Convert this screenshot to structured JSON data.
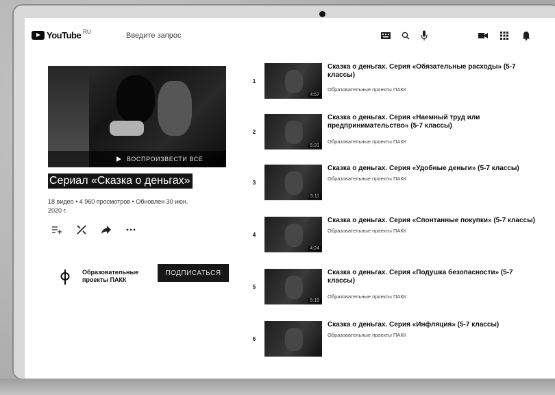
{
  "header": {
    "logo_text": "YouTube",
    "logo_country": "RU",
    "search_placeholder": "Введите запрос"
  },
  "playlist": {
    "play_all_label": "Воспроизвести все",
    "title": "Сериал «Сказка о деньгах»",
    "meta_line1": "18 видео • 4 960 просмотров • Обновлен 30 июн.",
    "meta_line2": "2020 г."
  },
  "channel": {
    "name_line1": "Образовательные",
    "name_line2": "проекты ПАКК",
    "subscribe_label": "Подписаться"
  },
  "videos": [
    {
      "index": "1",
      "title": "Сказка о деньгах. Серия «Обязательные расходы» (5-7 классы)",
      "channel": "Образовательные проекты ПАКК",
      "duration": "4:57"
    },
    {
      "index": "2",
      "title": "Сказка о деньгах. Серия «Наемный труд или предпринимательство» (5-7 классы)",
      "channel": "Образовательные проекты ПАКК",
      "duration": "5:31"
    },
    {
      "index": "3",
      "title": "Сказка о деньгах. Серия «Удобные деньги» (5-7 классы)",
      "channel": "Образовательные проекты ПАКК",
      "duration": "5:11"
    },
    {
      "index": "4",
      "title": "Сказка о деньгах. Серия «Спонтанные покупки» (5-7 классы)",
      "channel": "Образовательные проекты ПАКК",
      "duration": "4:24"
    },
    {
      "index": "5",
      "title": "Сказка о деньгах. Серия «Подушка безопасности» (5-7 классы)",
      "channel": "Образовательные проекты ПАКК",
      "duration": "5:19"
    },
    {
      "index": "6",
      "title": "Сказка о деньгах. Серия «Инфляция» (5-7 классы)",
      "channel": "Образовательные проекты ПАКК",
      "duration": ""
    }
  ]
}
